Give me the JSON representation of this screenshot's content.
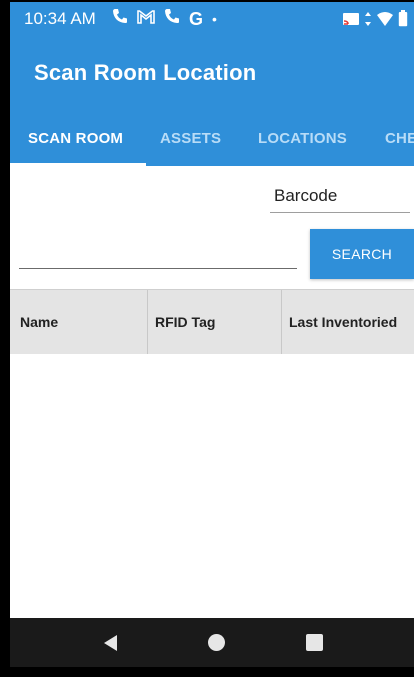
{
  "status_bar": {
    "time": "10:34 AM",
    "icons": [
      "phone-icon",
      "gmail-icon",
      "phone-icon",
      "google-icon",
      "dot-icon"
    ],
    "right_icons": [
      "cast-icon",
      "data-arrows-icon",
      "wifi-icon",
      "battery-icon"
    ]
  },
  "app_bar": {
    "title": "Scan Room Location"
  },
  "tabs": [
    {
      "label": "SCAN ROOM",
      "active": true
    },
    {
      "label": "ASSETS",
      "active": false
    },
    {
      "label": "LOCATIONS",
      "active": false
    },
    {
      "label": "CHE",
      "active": false
    }
  ],
  "scan": {
    "mode_selected": "Barcode",
    "input_value": "",
    "input_placeholder": "",
    "search_label": "SEARCH"
  },
  "table": {
    "columns": [
      "Name",
      "RFID Tag",
      "Last Inventoried"
    ],
    "rows": []
  },
  "nav": {
    "buttons": [
      "back-icon",
      "home-icon",
      "recents-icon"
    ]
  },
  "colors": {
    "primary": "#2f8fd9",
    "tab_inactive": "#b8dcf7",
    "header_bg": "#e4e4e4",
    "nav_bg": "#1a1a1a"
  }
}
